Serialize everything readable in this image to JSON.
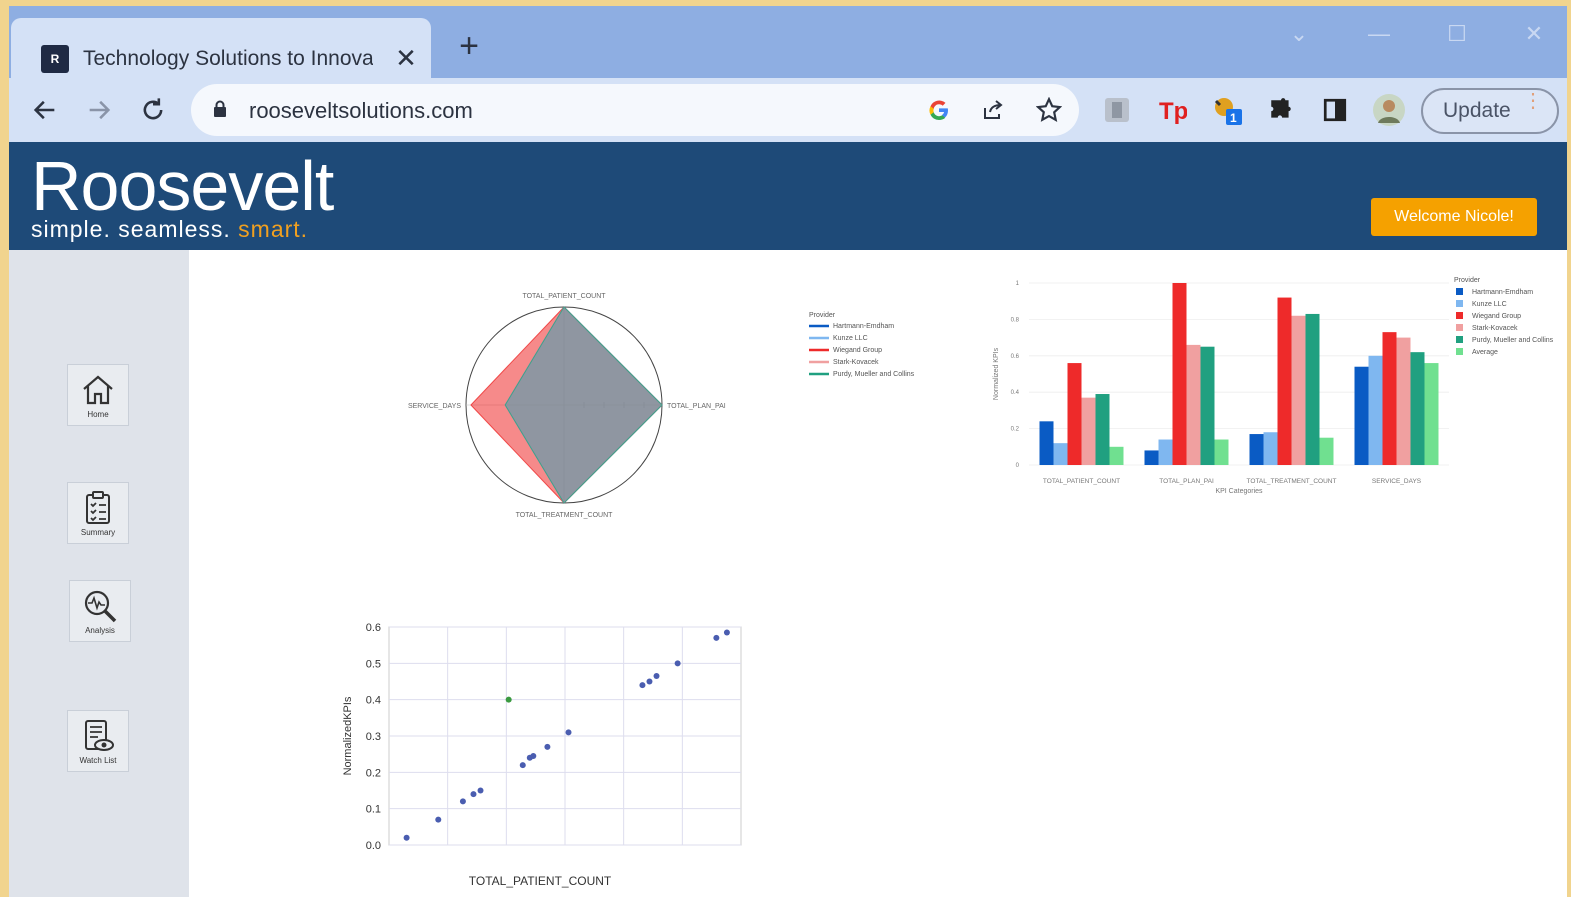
{
  "browser": {
    "tab_title": "Technology Solutions to Innovate",
    "favicon_text": "R",
    "close_tab": "✕",
    "new_tab": "+",
    "url": "rooseveltsolutions.com",
    "update_label": "Update",
    "controls": {
      "dropdown": "⌄",
      "minimize": "—",
      "maximize": "☐",
      "close": "✕"
    }
  },
  "site": {
    "logo_main": "Roosevelt",
    "tagline_prefix": "simple. seamless. ",
    "tagline_smart": "smart.",
    "welcome": "Welcome Nicole!",
    "sidebar": [
      {
        "label": "Home",
        "icon": "home-icon"
      },
      {
        "label": "Summary",
        "icon": "clipboard-icon"
      },
      {
        "label": "Analysis",
        "icon": "magnifier-pulse-icon"
      },
      {
        "label": "Watch List",
        "icon": "watchlist-icon"
      }
    ]
  },
  "colors": {
    "header_bg": "#1e4a78",
    "accent": "#f5a100",
    "series": [
      "#0a5bc4",
      "#7fb7f0",
      "#ee2a2a",
      "#f0a0a0",
      "#20a080",
      "#70e090"
    ]
  },
  "chart_data": [
    {
      "type": "radar",
      "axes": [
        "TOTAL_PATIENT_COUNT",
        "TOTAL_PLAN_PAI",
        "TOTAL_TREATMENT_COUNT",
        "SERVICE_DAYS"
      ],
      "rlim": [
        0,
        1
      ],
      "legend_title": "Provider",
      "legend_position": "right",
      "series": [
        {
          "name": "Hartmann-Emdham",
          "color": "#0a5bc4",
          "values": [
            1,
            1,
            1,
            0.6
          ]
        },
        {
          "name": "Kunze LLC",
          "color": "#7fb7f0",
          "values": [
            1,
            1,
            1,
            0.6
          ]
        },
        {
          "name": "Wiegand Group",
          "color": "#ee2a2a",
          "values": [
            1,
            1,
            1,
            0.95
          ]
        },
        {
          "name": "Stark-Kovacek",
          "color": "#f0a0a0",
          "values": [
            1,
            1,
            1,
            0.6
          ]
        },
        {
          "name": "Purdy, Mueller and Collins",
          "color": "#20a080",
          "values": [
            1,
            1,
            1,
            0.6
          ]
        }
      ]
    },
    {
      "type": "bar",
      "categories": [
        "TOTAL_PATIENT_COUNT",
        "TOTAL_PLAN_PAI",
        "TOTAL_TREATMENT_COUNT",
        "SERVICE_DAYS"
      ],
      "xlabel": "KPI Categories",
      "ylabel": "Normalized KPIs",
      "ylim": [
        0,
        1
      ],
      "yticks": [
        "0",
        "0.2",
        "0.4",
        "0.6",
        "0.8",
        "1"
      ],
      "legend_title": "Provider",
      "legend_position": "right",
      "series": [
        {
          "name": "Hartmann-Emdham",
          "color": "#0a5bc4",
          "values": [
            0.24,
            0.08,
            0.17,
            0.54
          ]
        },
        {
          "name": "Kunze LLC",
          "color": "#7fb7f0",
          "values": [
            0.12,
            0.14,
            0.18,
            0.6
          ]
        },
        {
          "name": "Wiegand Group",
          "color": "#ee2a2a",
          "values": [
            0.56,
            1.0,
            0.92,
            0.73
          ]
        },
        {
          "name": "Stark-Kovacek",
          "color": "#f0a0a0",
          "values": [
            0.37,
            0.66,
            0.82,
            0.7
          ]
        },
        {
          "name": "Purdy, Mueller and Collins",
          "color": "#20a080",
          "values": [
            0.39,
            0.65,
            0.83,
            0.62
          ]
        },
        {
          "name": "Average",
          "color": "#70e090",
          "values": [
            0.1,
            0.14,
            0.15,
            0.56
          ]
        }
      ]
    },
    {
      "type": "scatter",
      "xlabel": "TOTAL_PATIENT_COUNT",
      "ylabel": "NormalizedKPIs",
      "xlim": [
        0,
        1
      ],
      "ylim": [
        0,
        0.6
      ],
      "yticks": [
        "0.0",
        "0.1",
        "0.2",
        "0.3",
        "0.4",
        "0.5",
        "0.6"
      ],
      "grid": true,
      "points": [
        {
          "x": 0.05,
          "y": 0.02,
          "color": "#4a5db0"
        },
        {
          "x": 0.14,
          "y": 0.07,
          "color": "#4a5db0"
        },
        {
          "x": 0.21,
          "y": 0.12,
          "color": "#4a5db0"
        },
        {
          "x": 0.24,
          "y": 0.14,
          "color": "#4a5db0"
        },
        {
          "x": 0.26,
          "y": 0.15,
          "color": "#4a5db0"
        },
        {
          "x": 0.34,
          "y": 0.4,
          "color": "#3a9a40"
        },
        {
          "x": 0.38,
          "y": 0.22,
          "color": "#4a5db0"
        },
        {
          "x": 0.4,
          "y": 0.24,
          "color": "#4a5db0"
        },
        {
          "x": 0.41,
          "y": 0.245,
          "color": "#4a5db0"
        },
        {
          "x": 0.45,
          "y": 0.27,
          "color": "#4a5db0"
        },
        {
          "x": 0.51,
          "y": 0.31,
          "color": "#4a5db0"
        },
        {
          "x": 0.72,
          "y": 0.44,
          "color": "#4a5db0"
        },
        {
          "x": 0.74,
          "y": 0.45,
          "color": "#4a5db0"
        },
        {
          "x": 0.76,
          "y": 0.465,
          "color": "#4a5db0"
        },
        {
          "x": 0.82,
          "y": 0.5,
          "color": "#4a5db0"
        },
        {
          "x": 0.93,
          "y": 0.57,
          "color": "#4a5db0"
        },
        {
          "x": 0.96,
          "y": 0.585,
          "color": "#4a5db0"
        }
      ]
    }
  ]
}
